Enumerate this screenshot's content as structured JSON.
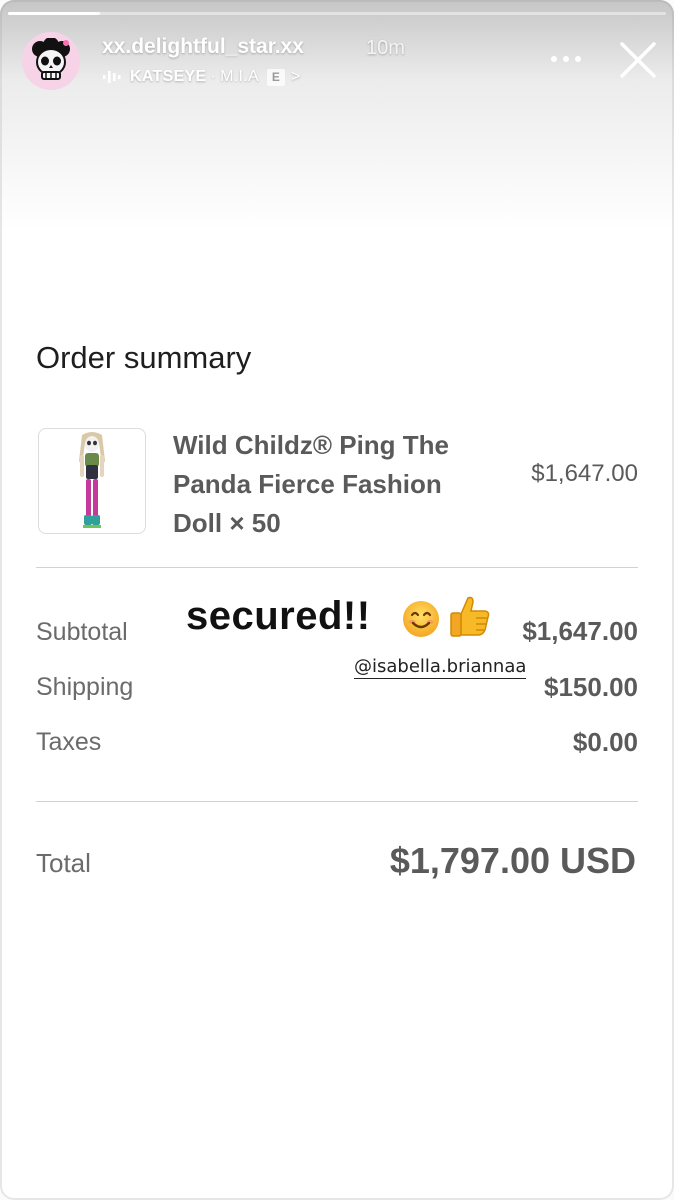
{
  "story": {
    "progress": 0.14,
    "username": "xx.delightful_star.xx",
    "time_ago": "10m",
    "music": {
      "artist": "KATSEYE",
      "separator": "·",
      "song": "M.I.A",
      "explicit_badge": "E",
      "chevron": ">"
    },
    "icons": {
      "avatar": "skull-avatar-icon",
      "more": "more-dots-icon",
      "close": "close-icon",
      "music": "audio-bars-icon"
    }
  },
  "sticker": {
    "text": "secured!!",
    "emojis": [
      "smiling-face-icon",
      "thumbs-up-icon"
    ],
    "mention": "@isabella.briannaa"
  },
  "order": {
    "title": "Order summary",
    "item": {
      "name": "Wild Childz® Ping The Panda Fierce Fashion Doll × 50",
      "price": "$1,647.00",
      "thumbnail": "doll-product-image"
    },
    "rows": [
      {
        "label": "Subtotal",
        "value": "$1,647.00"
      },
      {
        "label": "Shipping",
        "value": "$150.00"
      },
      {
        "label": "Taxes",
        "value": "$0.00"
      }
    ],
    "total": {
      "label": "Total",
      "value": "$1,797.00 USD"
    }
  }
}
